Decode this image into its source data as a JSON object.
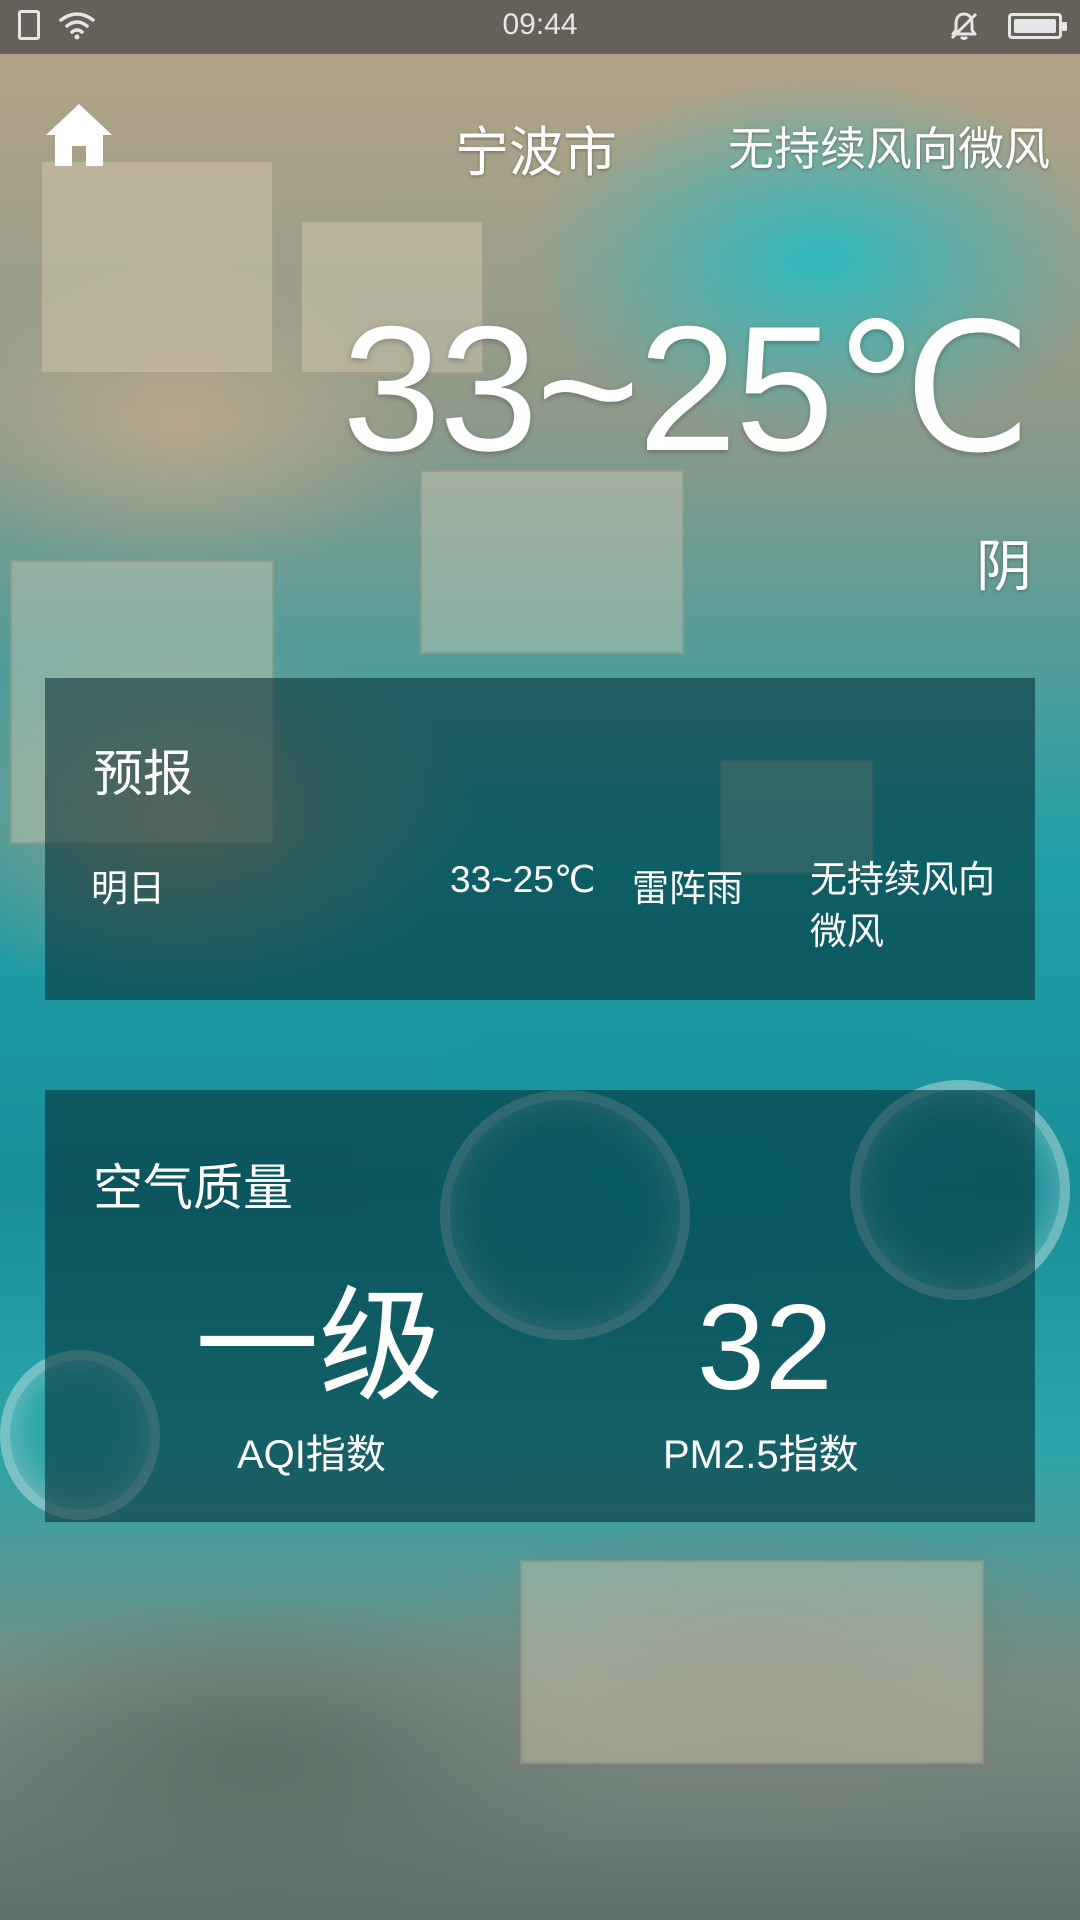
{
  "status_bar": {
    "time": "09:44",
    "icons": [
      "sim-icon",
      "wifi-icon",
      "mute-bell-icon",
      "battery-icon"
    ]
  },
  "header": {
    "home_icon": "home-icon",
    "city": "宁波市",
    "wind": "无持续风向微风"
  },
  "current": {
    "temperature": "33~25℃",
    "weather": "阴"
  },
  "forecast": {
    "title": "预报",
    "day": "明日",
    "temperature": "33~25℃",
    "weather": "雷阵雨",
    "wind": "无持续风向微风"
  },
  "air_quality": {
    "title": "空气质量",
    "aqi_level": "一级",
    "aqi_label": "AQI指数",
    "pm25_value": "32",
    "pm25_label": "PM2.5指数"
  },
  "colors": {
    "status_bar_bg": "#464646",
    "text": "#ffffff",
    "panel_bg": "#00282f"
  }
}
